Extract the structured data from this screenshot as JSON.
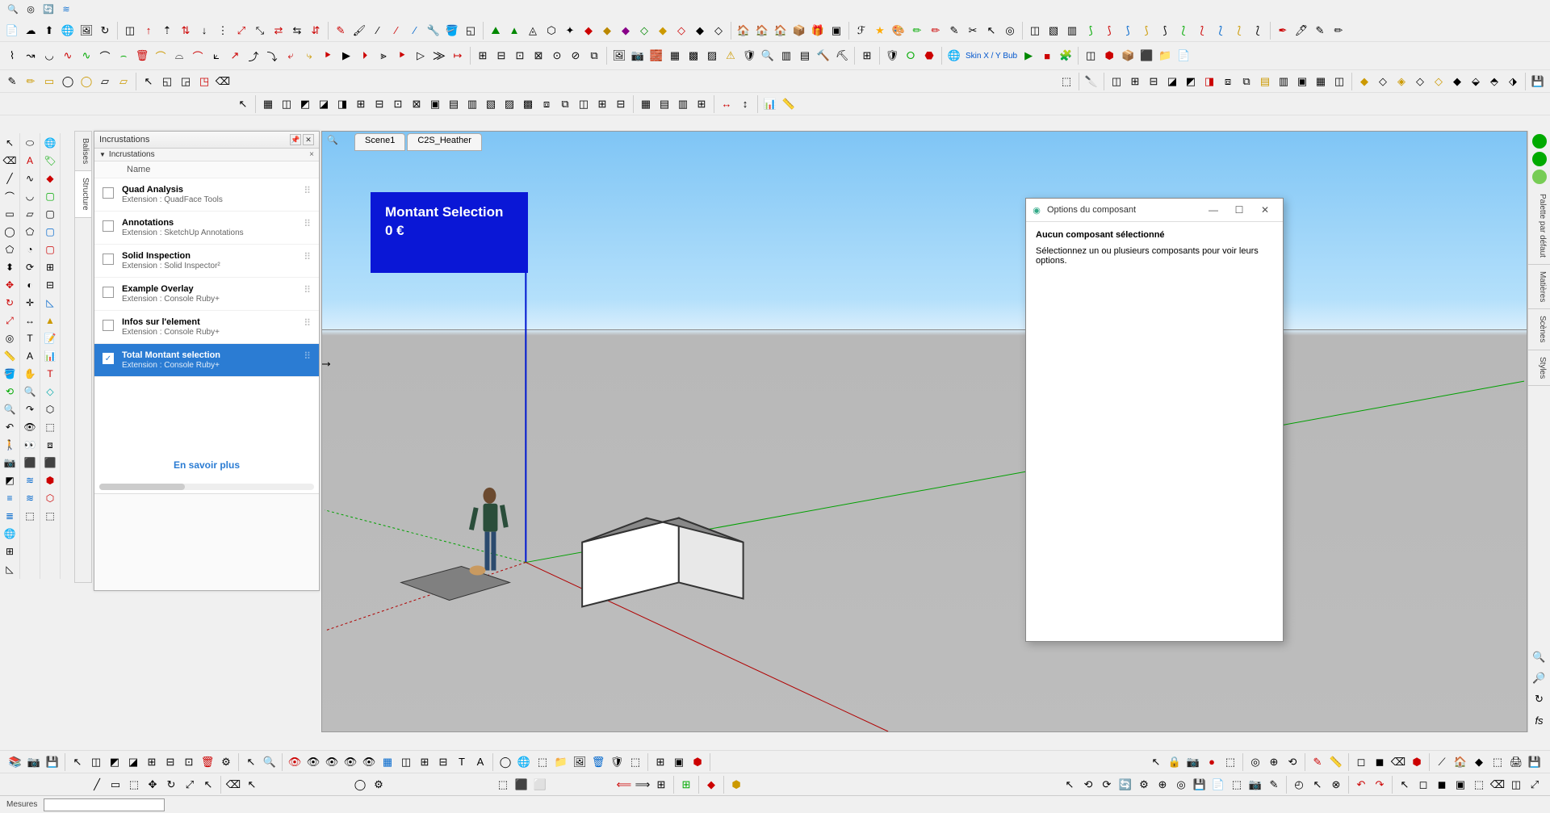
{
  "viewport_overlay": {
    "title": "Montant Selection",
    "value": "0 €"
  },
  "scene_tabs": [
    "Scene1",
    "C2S_Heather"
  ],
  "panel": {
    "title": "Incrustations",
    "section": "Incrustations",
    "col_name": "Name",
    "learn_more": "En savoir plus",
    "items": [
      {
        "name": "Quad Analysis",
        "ext": "Extension : QuadFace Tools",
        "checked": false
      },
      {
        "name": "Annotations",
        "ext": "Extension : SketchUp Annotations",
        "checked": false
      },
      {
        "name": "Solid Inspection",
        "ext": "Extension : Solid Inspector²",
        "checked": false
      },
      {
        "name": "Example Overlay",
        "ext": "Extension : Console Ruby+",
        "checked": false
      },
      {
        "name": "Infos sur l'element",
        "ext": "Extension : Console Ruby+",
        "checked": false
      },
      {
        "name": "Total Montant selection",
        "ext": "Extension : Console Ruby+",
        "checked": true
      }
    ]
  },
  "component_dialog": {
    "title": "Options du composant",
    "heading": "Aucun composant sélectionné",
    "message": "Sélectionnez un ou plusieurs composants pour voir leurs options."
  },
  "right_tabs": [
    "Palette par défaut",
    "Matières",
    "Scènes",
    "Styles"
  ],
  "left_vtabs": [
    "Balises",
    "Structure"
  ],
  "toolbar_text": {
    "skin": "Skin X / Y Bub"
  },
  "status": {
    "label": "Mesures"
  }
}
